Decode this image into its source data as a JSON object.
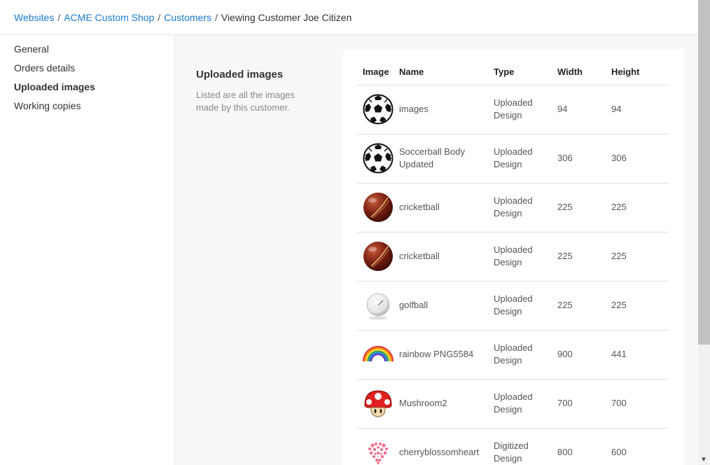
{
  "breadcrumb": {
    "items": [
      "Websites",
      "ACME Custom Shop",
      "Customers"
    ],
    "current": "Viewing Customer Joe Citizen",
    "separator": "/"
  },
  "sidebar": {
    "items": [
      {
        "label": "General"
      },
      {
        "label": "Orders details"
      },
      {
        "label": "Uploaded images"
      },
      {
        "label": "Working copies"
      }
    ]
  },
  "section": {
    "title": "Uploaded images",
    "description": "Listed are all the images made by this customer."
  },
  "table": {
    "headers": {
      "image": "Image",
      "name": "Name",
      "type": "Type",
      "width": "Width",
      "height": "Height"
    },
    "rows": [
      {
        "icon": "soccer-ball-icon",
        "name": "images",
        "type": "Uploaded Design",
        "width": "94",
        "height": "94"
      },
      {
        "icon": "soccer-ball-icon",
        "name": "Soccerball Body Updated",
        "type": "Uploaded Design",
        "width": "306",
        "height": "306"
      },
      {
        "icon": "cricket-ball-icon",
        "name": "cricketball",
        "type": "Uploaded Design",
        "width": "225",
        "height": "225"
      },
      {
        "icon": "cricket-ball-icon",
        "name": "cricketball",
        "type": "Uploaded Design",
        "width": "225",
        "height": "225"
      },
      {
        "icon": "golf-ball-icon",
        "name": "golfball",
        "type": "Uploaded Design",
        "width": "225",
        "height": "225"
      },
      {
        "icon": "rainbow-icon",
        "name": "rainbow PNG5584",
        "type": "Uploaded Design",
        "width": "900",
        "height": "441"
      },
      {
        "icon": "mushroom-icon",
        "name": "Mushroom2",
        "type": "Uploaded Design",
        "width": "700",
        "height": "700"
      },
      {
        "icon": "cherry-blossom-heart-icon",
        "name": "cherryblossomheart",
        "type": "Digitized Design",
        "width": "800",
        "height": "600"
      }
    ]
  },
  "colors": {
    "link": "#1a7ad4",
    "text": "#333333",
    "muted": "#888888",
    "panel": "#f8f8f8"
  }
}
